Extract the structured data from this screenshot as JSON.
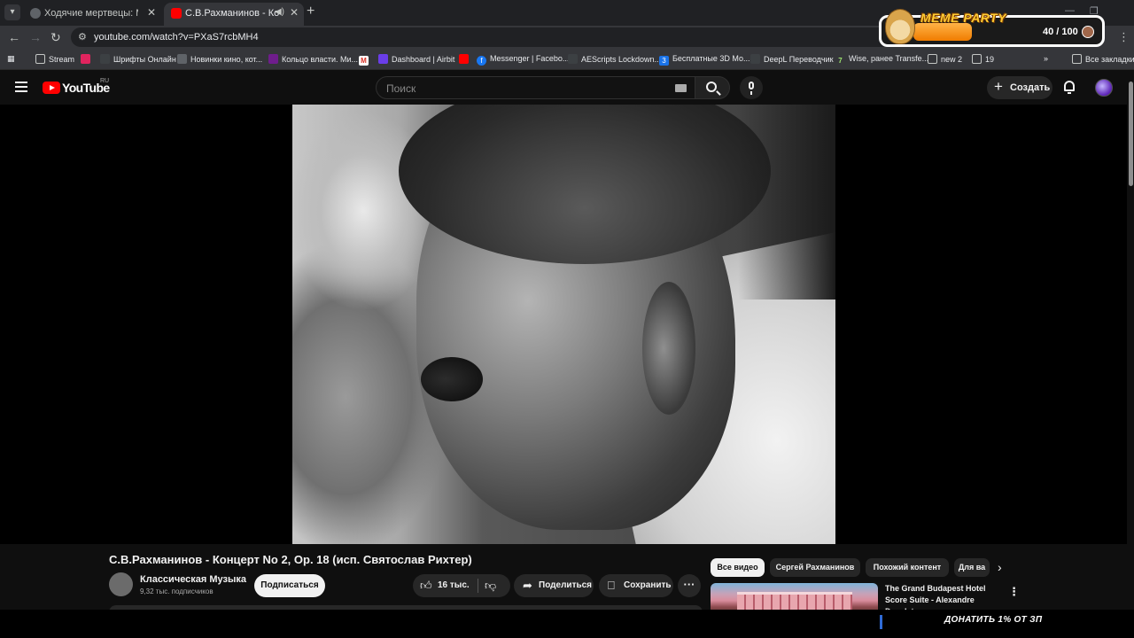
{
  "browser": {
    "tabs": [
      {
        "title": "Ходячие мертвецы: Мертвый",
        "active": false
      },
      {
        "title": "С.В.Рахманинов - Концерт",
        "active": true
      }
    ],
    "url": "youtube.com/watch?v=PXaS7rcbMH4",
    "bookmarks": [
      "Stream",
      "",
      "Шрифты Онлайн",
      "Новинки кино, кот...",
      "Кольцо власти. Ми...",
      "",
      "Dashboard | Airbit",
      "",
      "Messenger | Facebo...",
      "AEScripts Lockdown...",
      "Бесплатные 3D Мо...",
      "DeepL Переводчик",
      "Wise, ранее Transfe...",
      "new 2",
      "19"
    ],
    "all_bookmarks": "Все закладки"
  },
  "meme_widget": {
    "title": "MEME PARTY",
    "count": "40 / 100",
    "progress": 0.4
  },
  "youtube": {
    "region": "RU",
    "search_placeholder": "Поиск",
    "create_label": "Создать"
  },
  "video": {
    "title": "С.В.Рахманинов - Концерт No 2, Op. 18 (исп. Святослав Рихтер)",
    "channel": "Классическая Музыка",
    "subscribers": "9,32 тыс. подписчиков",
    "subscribe_label": "Подписаться",
    "likes": "16 тыс.",
    "share_label": "Поделиться",
    "save_label": "Сохранить"
  },
  "chips": [
    "Все видео",
    "Сергей Рахманинов",
    "Похожий контент",
    "Для ва"
  ],
  "recommendation": {
    "title": "The Grand Budapest Hotel Score Suite - Alexandre Desplat"
  },
  "overlay": {
    "donate": "ДОНАТИТЬ 1% ОТ ЗП"
  }
}
